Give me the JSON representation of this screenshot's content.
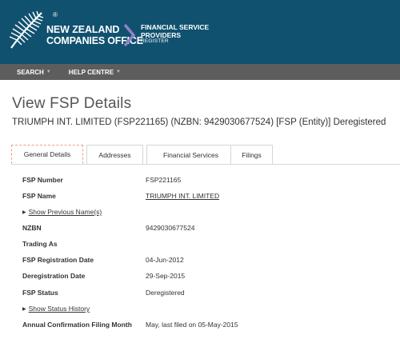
{
  "header": {
    "org_line1": "NEW ZEALAND",
    "org_line2": "COMPANIES OFFICE",
    "tm": "®",
    "register_line1": "FINANCIAL SERVICE",
    "register_line2": "PROVIDERS",
    "register_line3": "REGISTER",
    "bg_color": "#10516f"
  },
  "nav": {
    "items": [
      {
        "label": "SEARCH",
        "icon": "caret-down-icon"
      },
      {
        "label": "HELP CENTRE",
        "icon": "caret-down-icon"
      }
    ]
  },
  "page": {
    "title": "View FSP Details",
    "subtitle": "TRIUMPH INT. LIMITED (FSP221165) (NZBN: 9429030677524) [FSP (Entity)] Deregistered"
  },
  "tabs": [
    {
      "label": "General Details",
      "active": true
    },
    {
      "label": "Addresses",
      "active": false
    },
    {
      "label": "Financial Services",
      "active": false
    },
    {
      "label": "Filings",
      "active": false
    }
  ],
  "details": {
    "fsp_number_label": "FSP Number",
    "fsp_number": "FSP221165",
    "fsp_name_label": "FSP Name",
    "fsp_name": "TRIUMPH INT. LIMITED",
    "show_previous_names": "Show Previous Name(s)",
    "nzbn_label": "NZBN",
    "nzbn": "9429030677524",
    "trading_as_label": "Trading As",
    "registration_date_label": "FSP Registration Date",
    "registration_date": "04-Jun-2012",
    "deregistration_date_label": "Deregistration Date",
    "deregistration_date": "29-Sep-2015",
    "status_label": "FSP Status",
    "status": "Deregistered",
    "show_status_history": "Show Status History",
    "annual_filing_label": "Annual Confirmation Filing Month",
    "annual_filing": "May, last filed on 05-May-2015"
  }
}
